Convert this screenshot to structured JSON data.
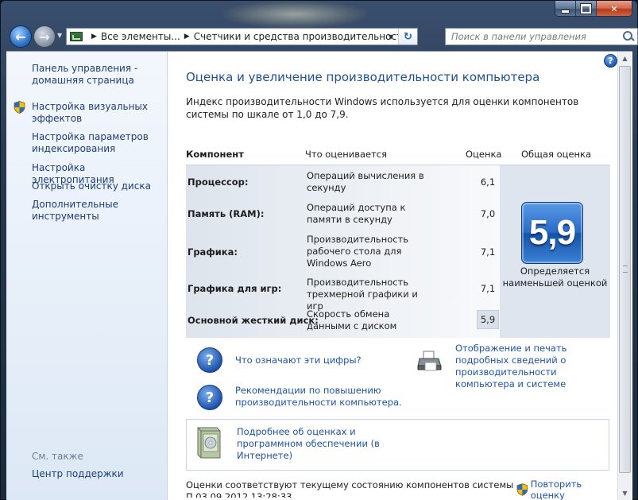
{
  "nav": {
    "address_crumbs": [
      "Все элементы...",
      "Счетчики и средства производительности"
    ],
    "search_placeholder": "Поиск в панели управления"
  },
  "sidebar": {
    "items": [
      {
        "label": "Панель управления - домашняя страница",
        "shield": false
      },
      {
        "label": "Настройка визуальных эффектов",
        "shield": true
      },
      {
        "label": "Настройка параметров индексирования",
        "shield": false
      },
      {
        "label": "Настройка электропитания",
        "shield": false
      },
      {
        "label": "Открыть очистку диска",
        "shield": false
      },
      {
        "label": "Дополнительные инструменты",
        "shield": false
      }
    ],
    "see_also": "См. также",
    "support_center": "Центр поддержки"
  },
  "main": {
    "title": "Оценка и увеличение производительности компьютера",
    "intro": "Индекс производительности Windows используется для оценки компонентов системы по шкале от 1,0 до 7,9.",
    "table": {
      "headers": {
        "component": "Компонент",
        "rated": "Что оценивается",
        "subscore": "Оценка",
        "base": "Общая оценка"
      },
      "rows": [
        {
          "component": "Процессор:",
          "rated": "Операций вычисления в секунду",
          "score": "6,1"
        },
        {
          "component": "Память (RAM):",
          "rated": "Операций доступа к памяти в секунду",
          "score": "7,0"
        },
        {
          "component": "Графика:",
          "rated": "Производительность рабочего стола для Windows Aero",
          "score": "7,1"
        },
        {
          "component": "Графика для игр:",
          "rated": "Производительность трехмерной графики и игр",
          "score": "7,1"
        },
        {
          "component": "Основной жесткий диск:",
          "rated": "Скорость обмена данными с диском",
          "score": "5,9"
        }
      ],
      "base_score": "5,9",
      "base_caption": "Определяется наименьшей оценкой"
    },
    "links": {
      "what_numbers": "Что означают эти цифры?",
      "tips": "Рекомендации по повышению производительности компьютера.",
      "print_details": "Отображение и печать подробных сведений о производительности компьютера и системе",
      "learn_more": "Подробнее об оценках и программном обеспечении (в Интернете)"
    },
    "footer": {
      "status": "Оценки соответствуют текущему состоянию компонентов системы",
      "last_update": "П                                          03.09.2012 13:28:33",
      "rerun": "Повторить оценку"
    }
  },
  "colors": {
    "link": "#1e52a8",
    "title": "#1d5193",
    "score_tile": "#2a6cc7"
  }
}
